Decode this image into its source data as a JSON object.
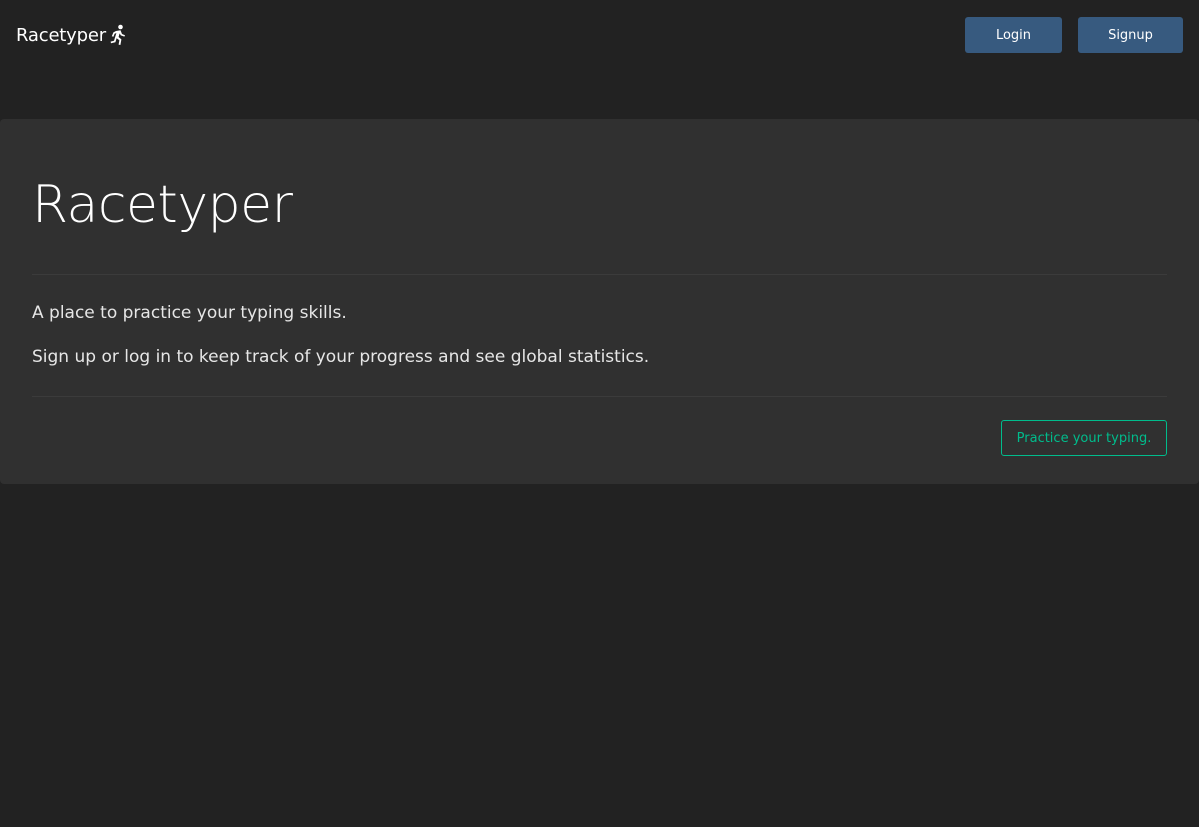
{
  "navbar": {
    "brand_label": "Racetyper",
    "brand_icon": "running-person-icon",
    "login_label": "Login",
    "signup_label": "Signup"
  },
  "jumbotron": {
    "title": "Racetyper",
    "lead_1": "A place to practice your typing skills.",
    "lead_2": "Sign up or log in to keep track of your progress and see global statistics.",
    "practice_label": "Practice your typing."
  },
  "colors": {
    "background": "#222222",
    "panel": "#303030",
    "primary": "#375a7f",
    "accent": "#00bc8c",
    "text": "#ffffff"
  }
}
